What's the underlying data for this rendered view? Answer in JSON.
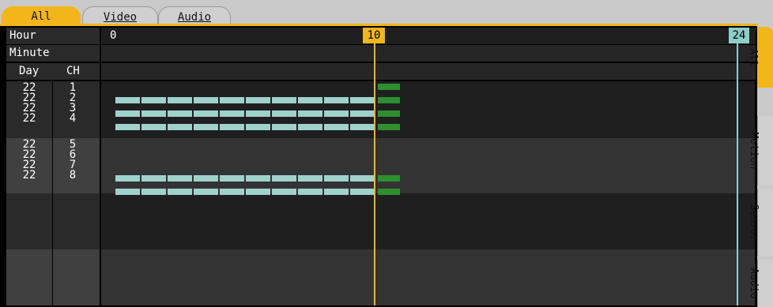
{
  "top_tabs": [
    {
      "label": "All"
    },
    {
      "label": "Video"
    },
    {
      "label": "Audio"
    }
  ],
  "header": {
    "hour_label": "Hour",
    "minute_label": "Minute",
    "day_label": "Day",
    "ch_label": "CH",
    "hour_start": "0",
    "current_marker": "10",
    "end_marker": "24"
  },
  "rows": [
    {
      "day": "22",
      "ch": "1"
    },
    {
      "day": "22",
      "ch": "2"
    },
    {
      "day": "22",
      "ch": "3"
    },
    {
      "day": "22",
      "ch": "4"
    },
    {
      "day": "22",
      "ch": "5"
    },
    {
      "day": "22",
      "ch": "6"
    },
    {
      "day": "22",
      "ch": "7"
    },
    {
      "day": "22",
      "ch": "8"
    }
  ],
  "side_tabs": [
    {
      "label": "All"
    },
    {
      "label": "Motion"
    },
    {
      "label": "Sensor"
    },
    {
      "label": "Audio"
    }
  ],
  "colors": {
    "accent": "#f2b51a",
    "recording": "#9fd1cd",
    "event": "#2e8f2e",
    "end_line": "#8ecfc9"
  }
}
